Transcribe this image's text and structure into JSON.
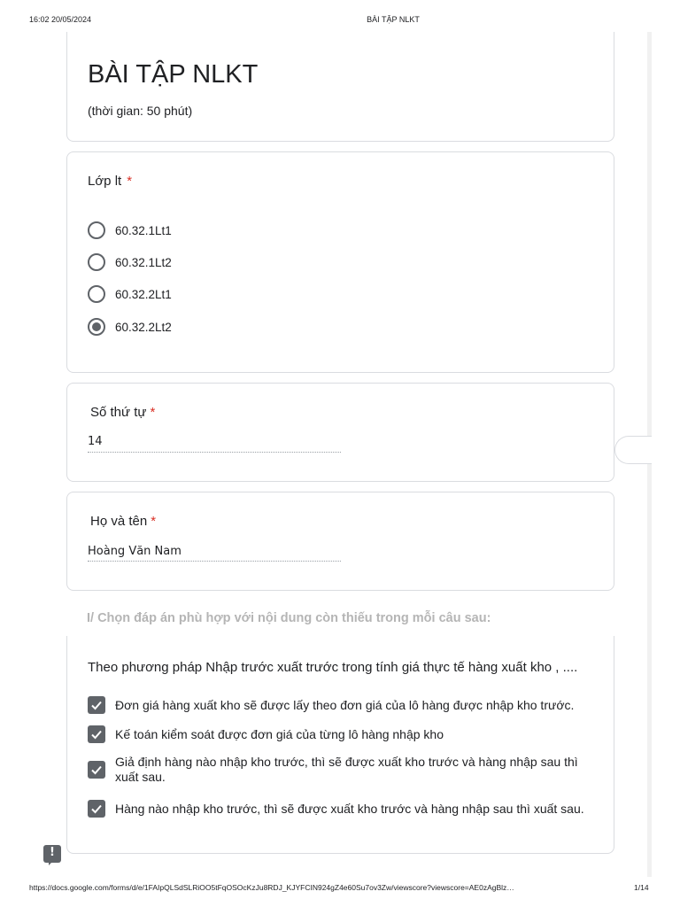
{
  "print_header": {
    "datetime": "16:02 20/05/2024",
    "doc_title": "BÀI TẬP NLKT"
  },
  "print_footer": {
    "url": "https://docs.google.com/forms/d/e/1FAIpQLSdSLRiOO5tFqOSOcKzJu8RDJ_KJYFCIN924gZ4e60Su7ov3Zw/viewscore?viewscore=AE0zAgBlz…",
    "page": "1/14"
  },
  "form": {
    "title": "BÀI TẬP NLKT",
    "description": "(thời gian: 50 phút)"
  },
  "class_question": {
    "label": "Lớp lt",
    "required_mark": "*",
    "options": [
      "60.32.1Lt1",
      "60.32.1Lt2",
      "60.32.2Lt1",
      "60.32.2Lt2"
    ],
    "selected": "60.32.2Lt2"
  },
  "stt_question": {
    "label": "Số thứ tự",
    "required_mark": "*",
    "answer": "14"
  },
  "name_question": {
    "label": "Họ và tên",
    "required_mark": "*",
    "answer": "Hoàng Văn Nam"
  },
  "section": {
    "heading": "I/ Chọn đáp án phù hợp với nội dung còn thiếu trong mỗi câu sau:"
  },
  "question_1": {
    "text": "Theo phương pháp Nhập trước xuất trước trong tính giá thực tế hàng xuất kho , ....",
    "options": [
      {
        "label": "Đơn giá hàng xuất kho sẽ được lấy theo đơn giá của lô hàng được nhập kho trước.",
        "checked": true
      },
      {
        "label": "Kế toán kiểm soát được đơn giá của từng lô hàng nhập kho",
        "checked": true
      },
      {
        "label": "Giả định hàng nào nhập kho trước, thì sẽ được xuất kho trước và hàng nhập sau thì xuất sau.",
        "checked": true
      },
      {
        "label": "Hàng nào nhập kho trước, thì sẽ được xuất kho trước và hàng nhập sau thì xuất sau.",
        "checked": true
      }
    ]
  },
  "feedback": {
    "icon": "report-feedback-icon",
    "glyph": "!"
  },
  "colors": {
    "border": "#dadce0",
    "control": "#5f6368",
    "required": "#d93025",
    "section_heading": "#b5b5b5"
  }
}
